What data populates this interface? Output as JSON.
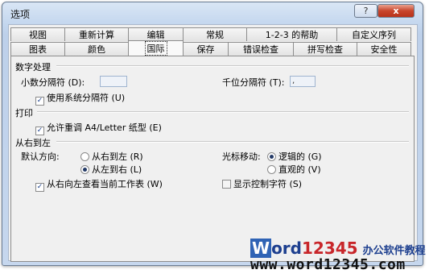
{
  "window": {
    "title": "选项",
    "help_label": "?",
    "close_label": "x"
  },
  "tabs_row1": [
    "视图",
    "重新计算",
    "编辑",
    "常规",
    "1-2-3 的帮助",
    "自定义序列"
  ],
  "tabs_row2": [
    "图表",
    "颜色",
    "国际",
    "保存",
    "错误检查",
    "拼写检查",
    "安全性"
  ],
  "active_tab": "国际",
  "number_section": {
    "heading": "数字处理",
    "decimal_label": "小数分隔符 (D):",
    "decimal_value": "",
    "thousands_label": "千位分隔符 (T):",
    "thousands_value": ",",
    "use_system_label": "使用系统分隔符 (U)",
    "use_system_checked": true
  },
  "print_section": {
    "heading": "打印",
    "allow_resize_label": "允许重调 A4/Letter 纸型 (E)",
    "allow_resize_checked": true
  },
  "rtl_section": {
    "heading": "从右到左",
    "default_dir_label": "默认方向:",
    "dir_rtl_label": "从右到左 (R)",
    "dir_ltr_label": "从左到右 (L)",
    "dir_selected": "ltr",
    "cursor_label": "光标移动:",
    "cursor_logical_label": "逻辑的 (G)",
    "cursor_visual_label": "直观的 (V)",
    "cursor_selected": "logical",
    "view_current_label": "从右向左查看当前工作表 (W)",
    "view_current_checked": true,
    "show_control_label": "显示控制字符 (S)",
    "show_control_checked": false
  },
  "watermark": {
    "brand_w": "W",
    "brand_ord": "ord",
    "brand_num": "12345",
    "brand_tag": "办公软件教程",
    "url": "www.word12345.com"
  },
  "colors": {
    "title_bg": "#c3d6ee",
    "close_red": "#c8452c",
    "panel": "#f0f0f0",
    "brand_blue": "#2f63b5",
    "brand_red": "#c8262a"
  }
}
